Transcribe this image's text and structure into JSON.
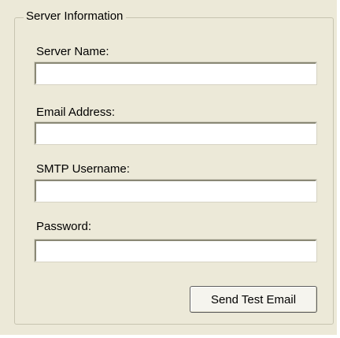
{
  "group": {
    "title": "Server Information"
  },
  "fields": [
    {
      "label": "Server Name:",
      "value": "",
      "placeholder": ""
    },
    {
      "label": "Email Address:",
      "value": "",
      "placeholder": ""
    },
    {
      "label": "SMTP Username:",
      "value": "",
      "placeholder": ""
    },
    {
      "label": "Password:",
      "value": "",
      "placeholder": ""
    }
  ],
  "actions": {
    "send_test_email_label": "Send Test Email"
  }
}
